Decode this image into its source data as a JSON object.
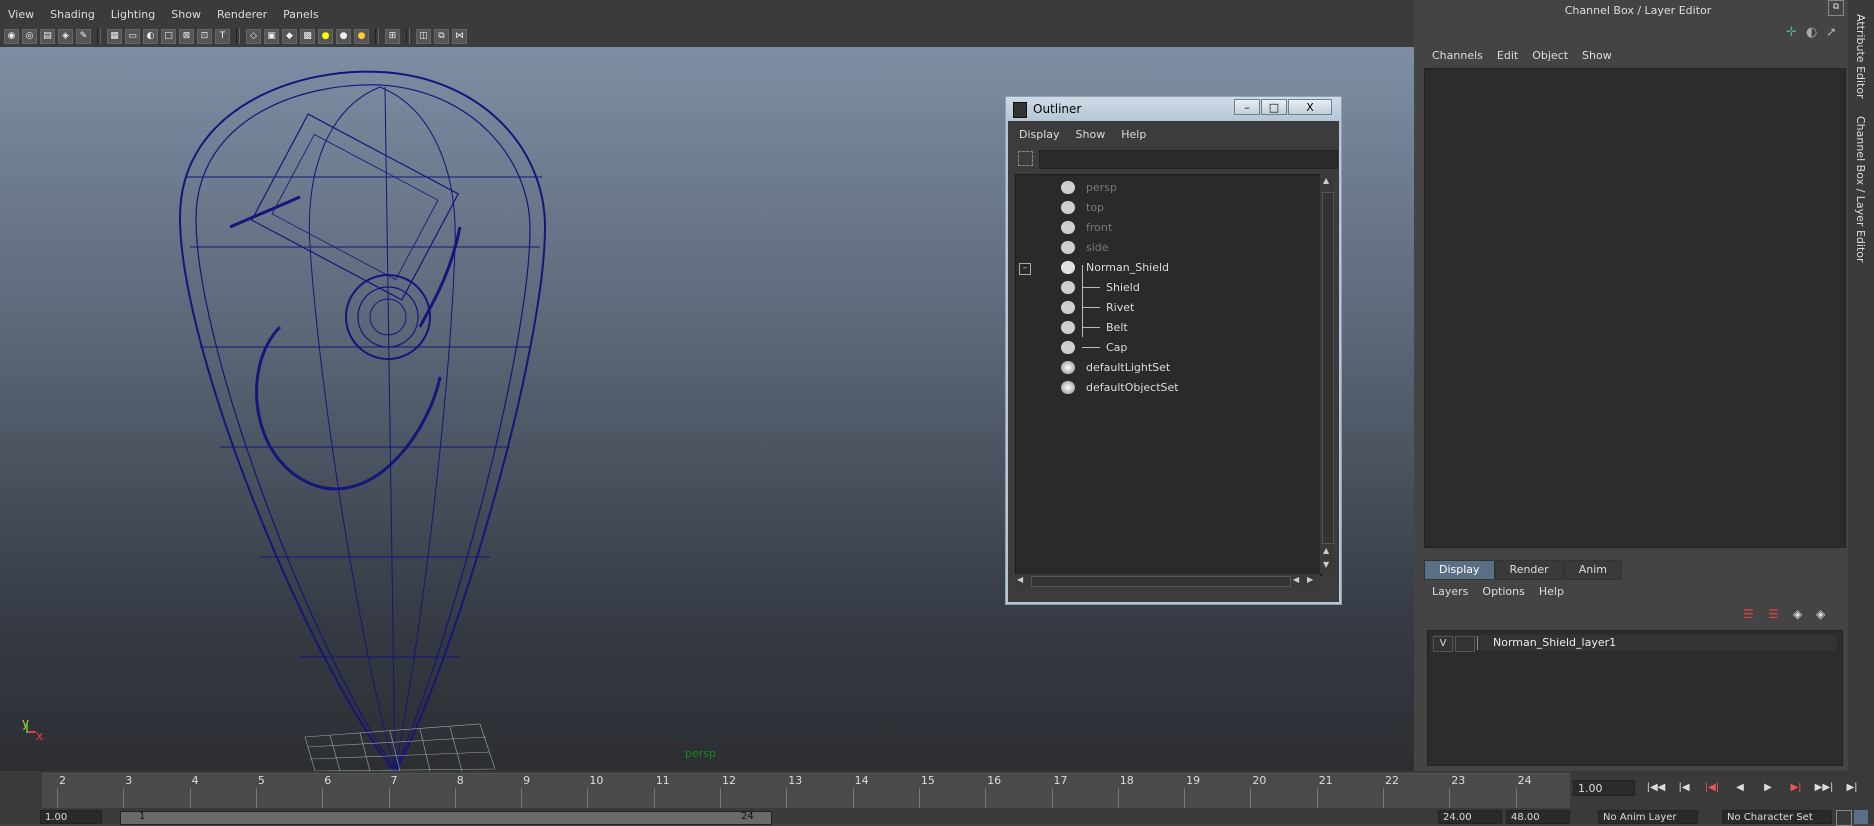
{
  "viewport": {
    "menu": [
      "View",
      "Shading",
      "Lighting",
      "Show",
      "Renderer",
      "Panels"
    ],
    "camera_label": "persp",
    "axis": {
      "y": "y",
      "x": "x"
    }
  },
  "outliner": {
    "title": "Outliner",
    "window_buttons": [
      "–",
      "□",
      "X"
    ],
    "menu": [
      "Display",
      "Show",
      "Help"
    ],
    "items": [
      {
        "label": "persp",
        "icon": "camera-icon",
        "dim": true
      },
      {
        "label": "top",
        "icon": "camera-icon",
        "dim": true
      },
      {
        "label": "front",
        "icon": "camera-icon",
        "dim": true
      },
      {
        "label": "side",
        "icon": "camera-icon",
        "dim": true
      },
      {
        "label": "Norman_Shield",
        "icon": "group-icon",
        "dim": false,
        "collapse": "–"
      },
      {
        "label": "Shield",
        "icon": "mesh-icon",
        "dim": false,
        "child": true
      },
      {
        "label": "Rivet",
        "icon": "mesh-icon",
        "dim": false,
        "child": true
      },
      {
        "label": "Belt",
        "icon": "mesh-icon",
        "dim": false,
        "child": true
      },
      {
        "label": "Cap",
        "icon": "mesh-icon",
        "dim": false,
        "child": true
      },
      {
        "label": "defaultLightSet",
        "icon": "set-icon",
        "dim": false
      },
      {
        "label": "defaultObjectSet",
        "icon": "set-icon",
        "dim": false
      }
    ]
  },
  "channel_box": {
    "title": "Channel Box / Layer Editor",
    "menu": [
      "Channels",
      "Edit",
      "Object",
      "Show"
    ]
  },
  "layer_editor": {
    "tabs": [
      "Display",
      "Render",
      "Anim"
    ],
    "active_tab": "Display",
    "menu": [
      "Layers",
      "Options",
      "Help"
    ],
    "layer": {
      "visibility": "V",
      "name": "Norman_Shield_layer1"
    }
  },
  "side_tabs": [
    "Attribute Editor",
    "Channel Box / Layer Editor"
  ],
  "timeline": {
    "ticks": [
      "2",
      "3",
      "4",
      "5",
      "6",
      "7",
      "8",
      "9",
      "10",
      "11",
      "12",
      "13",
      "14",
      "15",
      "16",
      "17",
      "18",
      "19",
      "20",
      "21",
      "22",
      "23",
      "24"
    ],
    "current_frame": "1.00",
    "range": {
      "start": "1.00",
      "slider_start": "1",
      "slider_end": "24",
      "end": "24.00",
      "playback_end": "48.00",
      "anim_layer": "No Anim Layer",
      "character_set": "No Character Set"
    },
    "playback_buttons": [
      "|◀◀",
      "|◀",
      "|◀|",
      "◀",
      "▶",
      "▶|",
      "▶▶|",
      "▶|"
    ]
  },
  "colors": {
    "wireframe": "#15157a",
    "accent_tab": "#5a6e85",
    "camera_label": "#1a8a1a"
  }
}
